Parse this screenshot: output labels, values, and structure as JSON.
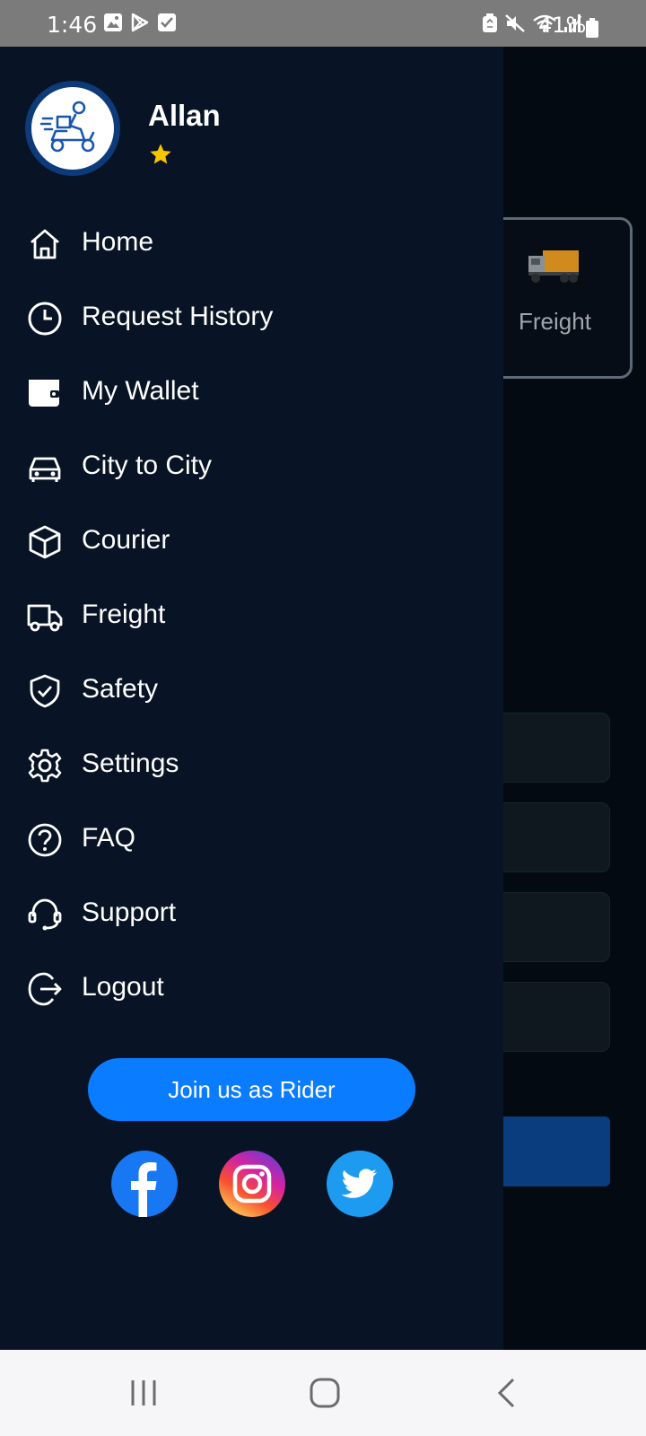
{
  "status_bar": {
    "time": "1:46",
    "battery": "41%",
    "left_icons": [
      "gallery-icon",
      "play-store-icon",
      "checkbox-icon"
    ],
    "right_icons": [
      "recycle-icon",
      "mute-icon",
      "wifi-icon",
      "signal-icon",
      "battery-icon"
    ]
  },
  "background_app": {
    "freight_card_label": "Freight"
  },
  "drawer": {
    "user": {
      "name": "Allan",
      "avatar_icon": "courier-scooter-icon",
      "rating_icon": "star-icon"
    },
    "menu": [
      {
        "label": "Home",
        "icon": "home-icon"
      },
      {
        "label": "Request History",
        "icon": "clock-icon"
      },
      {
        "label": "My Wallet",
        "icon": "wallet-icon"
      },
      {
        "label": "City to City",
        "icon": "car-icon"
      },
      {
        "label": "Courier",
        "icon": "box-icon"
      },
      {
        "label": "Freight",
        "icon": "truck-icon"
      },
      {
        "label": "Safety",
        "icon": "shield-check-icon"
      },
      {
        "label": "Settings",
        "icon": "gear-icon"
      },
      {
        "label": "FAQ",
        "icon": "question-icon"
      },
      {
        "label": "Support",
        "icon": "headset-icon"
      },
      {
        "label": "Logout",
        "icon": "logout-icon"
      }
    ],
    "join_button": "Join us as Rider",
    "social": [
      "facebook-icon",
      "instagram-icon",
      "twitter-icon"
    ]
  },
  "colors": {
    "drawer_bg": "#081425",
    "accent": "#0a7cff",
    "star": "#f7c600"
  },
  "nav_bar": [
    "recent-apps-icon",
    "home-button-icon",
    "back-icon"
  ]
}
